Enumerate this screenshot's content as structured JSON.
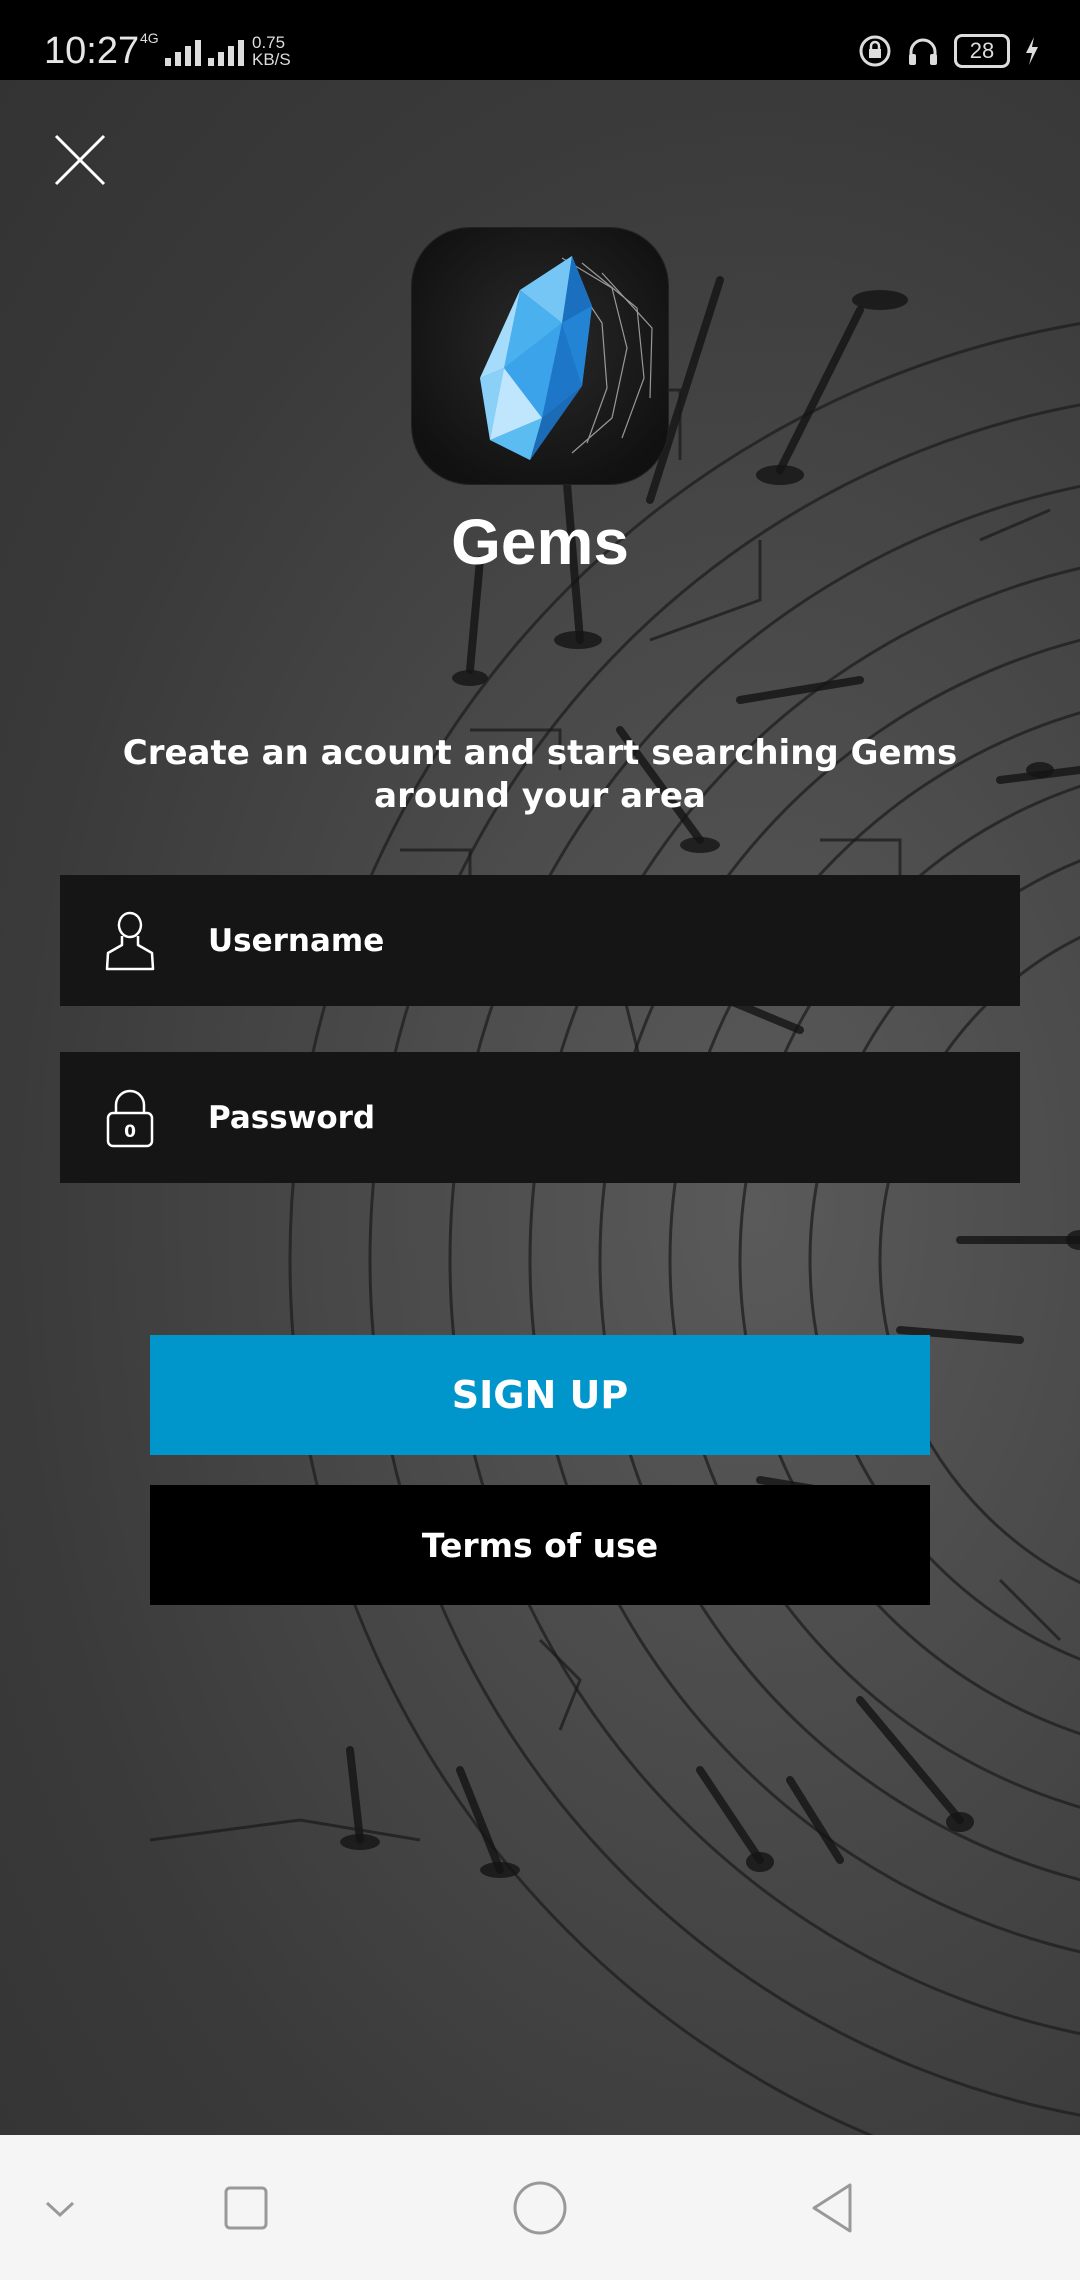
{
  "status_bar": {
    "time": "10:27",
    "network": "4G",
    "speed_value": "0.75",
    "speed_unit": "KB/S",
    "battery": "28"
  },
  "app": {
    "name": "Gems",
    "tagline": "Create an acount and start searching Gems around your area"
  },
  "form": {
    "username_placeholder": "Username",
    "password_placeholder": "Password"
  },
  "buttons": {
    "signup_label": "SIGN UP",
    "terms_label": "Terms of use"
  },
  "colors": {
    "accent": "#0096cc",
    "field_bg": "#151515",
    "nav_bg": "#f5f5f5"
  },
  "icons": {
    "close": "close-icon",
    "user": "user-icon",
    "lock": "lock-icon",
    "gem": "gem-icon"
  },
  "lock_icon_digit": "0"
}
